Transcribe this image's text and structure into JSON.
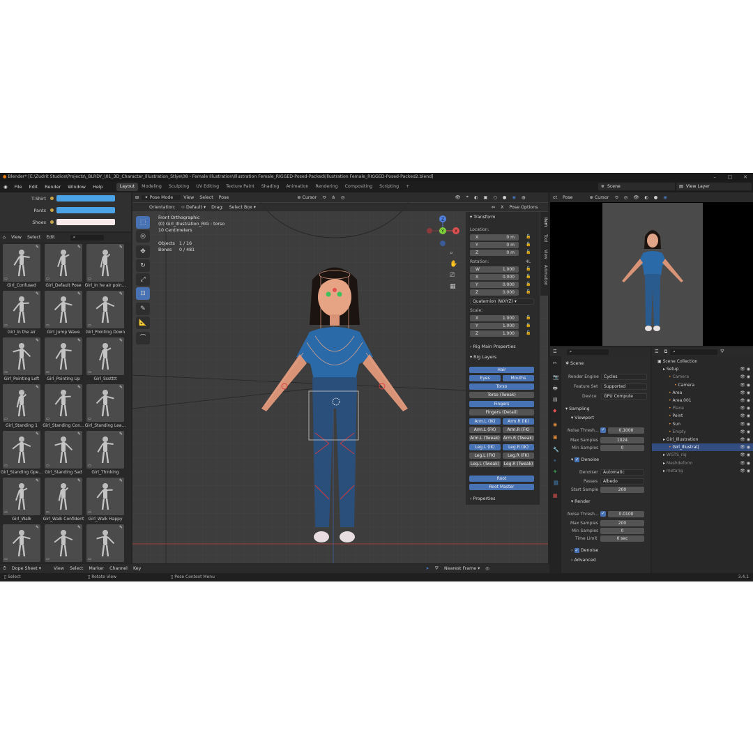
{
  "titlebar": {
    "title": "Blender* [E:\\Zudrit Studios\\Projects\\_BLRDY_\\01_3D_Character_Illustration_Stlye\\08 - Female Illustration\\Illustration Female_RIGGED-Posed-Packed\\Illustration Female_RIGGED-Posed-Packed2.blend]"
  },
  "menu": [
    "File",
    "Edit",
    "Render",
    "Window",
    "Help"
  ],
  "workspaces": [
    "Layout",
    "Modeling",
    "Sculpting",
    "UV Editing",
    "Texture Paint",
    "Shading",
    "Animation",
    "Rendering",
    "Compositing",
    "Scripting",
    "+"
  ],
  "scene": {
    "name": "Scene",
    "view_layer": "View Layer"
  },
  "color_props": [
    {
      "label": "T-Shirt",
      "color": "#4aa3e6"
    },
    {
      "label": "Pants",
      "color": "#4aa3e6"
    },
    {
      "label": "Shoes",
      "color": "#f8e9ea"
    }
  ],
  "pose_lib": {
    "menu": [
      "View",
      "Select",
      "Edit"
    ],
    "items": [
      "Girl_Confused",
      "Girl_Default Pose",
      "Girl_In he air poin...",
      "Girl_In the air",
      "Girl_Jump Wave",
      "Girl_Pointing Down",
      "Girl_Pointing Left",
      "Girl_Pointing Up",
      "Girl_Ssstttt",
      "Girl_Standing 1",
      "Girl_Standing Con...",
      "Girl_Standing Lea...",
      "Girl_Standing Ope...",
      "Girl_Standing Sad",
      "Girl_Thinking",
      "Girl_Walk",
      "Girl_Walk Confident",
      "Girl_Walk Happy",
      "",
      "",
      ""
    ]
  },
  "viewport": {
    "mode": "Pose Mode",
    "menu": [
      "View",
      "Select",
      "Pose"
    ],
    "orientation_label": "Orientation:",
    "orientation": "Default",
    "drag_label": "Drag:",
    "drag": "Select Box",
    "pivot": "Cursor",
    "pose_options": "Pose Options",
    "info_line1": "Front Orthographic",
    "info_line2": "(0) Girl_Illustration_RIG : torso",
    "info_line3": "10 Centimeters",
    "objects_label": "Objects",
    "objects_value": "1 / 16",
    "bones_label": "Bones",
    "bones_value": "0 / 481",
    "gizmo": {
      "x": "X",
      "y": "Y",
      "z": "Z"
    }
  },
  "npanel": {
    "tabs": [
      "Item",
      "Tool",
      "View",
      "Animation"
    ],
    "transform_title": "Transform",
    "location_label": "Location:",
    "location": [
      {
        "axis": "X",
        "value": "0 m"
      },
      {
        "axis": "Y",
        "value": "0 m"
      },
      {
        "axis": "Z",
        "value": "0 m"
      }
    ],
    "rotation_label": "Rotation:",
    "rotation_mode_tag": "4L",
    "rotation": [
      {
        "axis": "W",
        "value": "1.000"
      },
      {
        "axis": "X",
        "value": "0.000"
      },
      {
        "axis": "Y",
        "value": "0.000"
      },
      {
        "axis": "Z",
        "value": "0.000"
      }
    ],
    "rotation_mode": "Quaternion (WXYZ)",
    "scale_label": "Scale:",
    "scale": [
      {
        "axis": "X",
        "value": "1.000"
      },
      {
        "axis": "Y",
        "value": "1.000"
      },
      {
        "axis": "Z",
        "value": "1.000"
      }
    ],
    "rig_main_title": "Rig Main Properties",
    "rig_layers_title": "Rig Layers",
    "layers": {
      "hair": "Hair",
      "eyes": "Eyes",
      "mouths": "Mouths",
      "torso": "Torso",
      "torso_tweak": "Torso (Tweak)",
      "fingers": "Fingers",
      "fingers_detail": "Fingers (Detail)",
      "arm_l_ik": "Arm.L (IK)",
      "arm_r_ik": "Arm.R (IK)",
      "arm_l_fk": "Arm.L (FK)",
      "arm_r_fk": "Arm.R (FK)",
      "arm_l_tweak": "Arm.L (Tweak)",
      "arm_r_tweak": "Arm.R (Tweak)",
      "leg_l_ik": "Leg.L (IK)",
      "leg_r_ik": "Leg.R (IK)",
      "leg_l_fk": "Leg.L (FK)",
      "leg_r_fk": "Leg.R (FK)",
      "leg_l_tweak": "Leg.L (Tweak)",
      "leg_r_tweak": "Leg.R (Tweak)",
      "root": "Root",
      "root_master": "Root Master"
    },
    "properties_title": "Properties"
  },
  "render_view": {
    "menu_left": "ct",
    "menu": [
      "Pose"
    ],
    "pivot": "Cursor"
  },
  "properties_editor": {
    "context": "Scene",
    "render_engine_label": "Render Engine",
    "render_engine": "Cycles",
    "feature_set_label": "Feature Set",
    "feature_set": "Supported",
    "device_label": "Device",
    "device": "GPU Compute",
    "sampling": "Sampling",
    "viewport": "Viewport",
    "noise_label": "Noise Thresh...",
    "vp_noise": "0.1000",
    "max_samples_label": "Max Samples",
    "vp_max": "1024",
    "min_samples_label": "Min Samples",
    "vp_min": "0",
    "denoise": "Denoise",
    "denoiser_label": "Denoiser",
    "denoiser": "Automatic",
    "passes_label": "Passes",
    "passes": "Albedo",
    "start_sample_label": "Start Sample",
    "start_sample": "200",
    "render": "Render",
    "r_noise": "0.0100",
    "r_max": "200",
    "r_min": "0",
    "time_limit_label": "Time Limit",
    "time_limit": "0 sec",
    "r_denoise": "Denoise",
    "advanced": "Advanced"
  },
  "outliner": {
    "rows": [
      {
        "label": "Scene Collection",
        "indent": 0,
        "color": "#d0d0d0"
      },
      {
        "label": "Setup",
        "indent": 1,
        "color": "#d0d0d0"
      },
      {
        "label": "Camera",
        "indent": 2,
        "color": "#8a8a8a"
      },
      {
        "label": "Camera",
        "indent": 3,
        "color": "#d0d0d0"
      },
      {
        "label": "Area",
        "indent": 2,
        "color": "#d0d0d0"
      },
      {
        "label": "Area.001",
        "indent": 2,
        "color": "#d0d0d0"
      },
      {
        "label": "Plane",
        "indent": 2,
        "color": "#8a8a8a"
      },
      {
        "label": "Point",
        "indent": 2,
        "color": "#d0d0d0"
      },
      {
        "label": "Sun",
        "indent": 2,
        "color": "#d0d0d0"
      },
      {
        "label": "Empty",
        "indent": 2,
        "color": "#8a8a8a"
      },
      {
        "label": "Girl_Illustration",
        "indent": 1,
        "color": "#d0d0d0"
      },
      {
        "label": "Girl_Illustrat|",
        "indent": 2,
        "color": "#ffffff"
      },
      {
        "label": "WGTS_rig",
        "indent": 1,
        "color": "#8a8a8a"
      },
      {
        "label": "Meshdeform",
        "indent": 1,
        "color": "#8a8a8a"
      },
      {
        "label": "metarig",
        "indent": 1,
        "color": "#8a8a8a"
      }
    ]
  },
  "timeline": {
    "editor": "Dope Sheet",
    "menu": [
      "View",
      "Select",
      "Marker",
      "Channel",
      "Key"
    ],
    "snap": "Nearest Frame"
  },
  "status": {
    "select": "Select",
    "rotate": "Rotate View",
    "context": "Pose Context Menu",
    "version": "3.4.1"
  },
  "colors": {
    "accent": "#4772b3",
    "bg": "#232323",
    "panel": "#303030",
    "bone": "#e0683a"
  }
}
